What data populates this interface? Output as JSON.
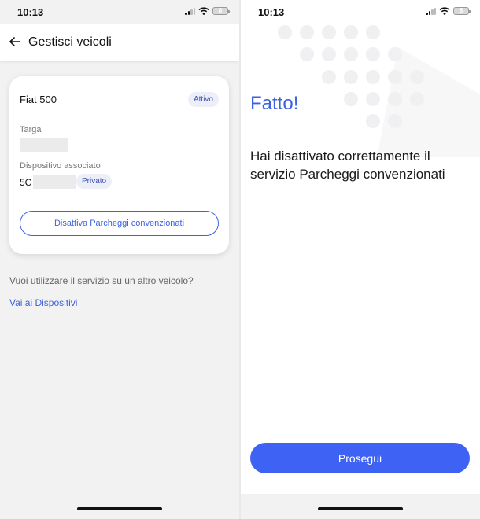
{
  "left": {
    "status": {
      "time": "10:13",
      "battery": "8"
    },
    "header": {
      "title": "Gestisci veicoli"
    },
    "card": {
      "vehicle_name": "Fiat 500",
      "status_badge": "Attivo",
      "plate_label": "Targa",
      "device_label": "Dispositivo associato",
      "device_prefix": "5C",
      "device_badge": "Privato",
      "deactivate_button": "Disattiva Parcheggi convenzionati"
    },
    "question": "Vuoi utilizzare il servizio su un altro veicolo?",
    "devices_link": "Vai ai Dispositivi"
  },
  "right": {
    "status": {
      "time": "10:13",
      "battery": "8"
    },
    "title": "Fatto!",
    "message": "Hai disattivato correttamente il servizio Parcheggi convenzionati",
    "continue_button": "Prosegui"
  },
  "icons": {
    "back": "arrow-left-icon",
    "signal": "cellular-signal-icon",
    "wifi": "wifi-icon",
    "battery": "battery-icon"
  },
  "colors": {
    "accent": "#3d62f4",
    "link": "#3d62e0",
    "badge_text": "#3b4fb3"
  }
}
